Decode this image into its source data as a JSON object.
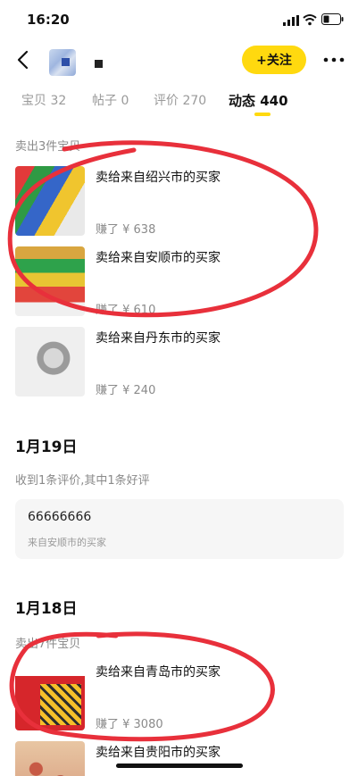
{
  "status_bar": {
    "time": "16:20"
  },
  "header": {
    "follow_label": "+关注"
  },
  "tabs": [
    {
      "label": "宝贝",
      "count": "32"
    },
    {
      "label": "帖子",
      "count": "0"
    },
    {
      "label": "评价",
      "count": "270"
    },
    {
      "label": "动态",
      "count": "440"
    }
  ],
  "feed": {
    "group1_label": "卖出3件宝贝",
    "items1": [
      {
        "title": "卖给来自绍兴市的买家",
        "earned": "赚了 ¥ 638"
      },
      {
        "title": "卖给来自安顺市的买家",
        "earned": "赚了 ¥ 610"
      },
      {
        "title": "卖给来自丹东市的买家",
        "earned": "赚了 ¥ 240"
      }
    ],
    "date1": "1月19日",
    "review_summary": "收到1条评价,其中1条好评",
    "review": {
      "text": "66666666",
      "source": "来自安顺市的买家"
    },
    "date2": "1月18日",
    "group2_label": "卖出7件宝贝",
    "items2": [
      {
        "title": "卖给来自青岛市的买家",
        "earned": "赚了 ¥ 3080"
      },
      {
        "title": "卖给来自贵阳市的买家",
        "earned": ""
      }
    ]
  },
  "colors": {
    "accent": "#ffd90f",
    "annotation": "#e8303b"
  },
  "icons": [
    "signal-icon",
    "wifi-icon",
    "battery-icon",
    "back-icon",
    "more-icon"
  ]
}
